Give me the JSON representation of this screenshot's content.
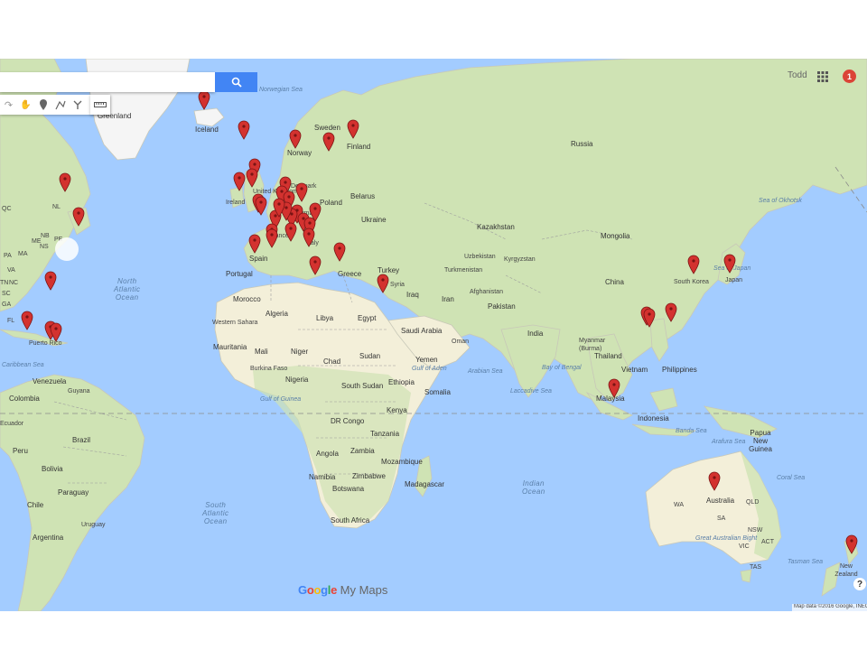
{
  "search": {
    "placeholder": "",
    "button_icon": "search-icon"
  },
  "toolbar": {
    "tools": [
      {
        "name": "redo-button",
        "icon": "redo-icon",
        "glyph": "↷"
      },
      {
        "name": "hand-button",
        "icon": "hand-icon",
        "glyph": "✋"
      },
      {
        "name": "add-marker-button",
        "icon": "marker-icon",
        "glyph": "⚲"
      },
      {
        "name": "draw-line-button",
        "icon": "polyline-icon",
        "glyph": "⟋"
      },
      {
        "name": "directions-button",
        "icon": "directions-icon",
        "glyph": "⑂"
      }
    ],
    "ruler_icon": "ruler-icon"
  },
  "account": {
    "user_name": "Todd",
    "apps_icon": "apps-grid-icon",
    "notification_count": "1"
  },
  "branding": {
    "google": "Google",
    "product": "My Maps"
  },
  "attribution": "Map data ©2016 Google, INEGI",
  "help_label": "?",
  "colors": {
    "ocean": "#a3ccff",
    "land": "#e9efd9",
    "marker": "#d3322f",
    "search_button": "#4285f4",
    "notification": "#db4437"
  },
  "labels": {
    "oceans": [
      {
        "id": "north-atlantic",
        "text": "North\nAtlantic\nOcean"
      },
      {
        "id": "south-atlantic",
        "text": "South\nAtlantic\nOcean"
      },
      {
        "id": "indian",
        "text": "Indian\nOcean"
      }
    ],
    "seas": [
      "Norwegian Sea",
      "Caribbean Sea",
      "Arabian Sea",
      "Bay of Bengal",
      "Laccadive Sea",
      "Sea of Japan",
      "Sea of Okhotsk",
      "Coral Sea",
      "Tasman Sea",
      "Gulf of Aden",
      "Gulf of Guinea",
      "Arafura Sea",
      "Banda Sea",
      "Great Australian Bight"
    ],
    "countries": [
      "Greenland",
      "Iceland",
      "Norway",
      "Sweden",
      "Finland",
      "Russia",
      "Denmark",
      "United Kingdom",
      "Ireland",
      "Poland",
      "Belarus",
      "Ukraine",
      "Germany",
      "France",
      "Spain",
      "Portugal",
      "Italy",
      "Greece",
      "Turkey",
      "Kazakhstan",
      "Mongolia",
      "Uzbekistan",
      "Kyrgyzstan",
      "Turkmenistan",
      "Afghanistan",
      "Pakistan",
      "Iran",
      "Iraq",
      "Syria",
      "Saudi Arabia",
      "Yemen",
      "Oman",
      "Egypt",
      "Libya",
      "Algeria",
      "Morocco",
      "Western Sahara",
      "Mauritania",
      "Mali",
      "Niger",
      "Chad",
      "Sudan",
      "South Sudan",
      "Ethiopia",
      "Kenya",
      "Somalia",
      "Nigeria",
      "Burkina Faso",
      "DR Congo",
      "Tanzania",
      "Angola",
      "Zambia",
      "Namibia",
      "Zimbabwe",
      "Botswana",
      "Mozambique",
      "Madagascar",
      "South Africa",
      "India",
      "China",
      "Myanmar (Burma)",
      "Thailand",
      "Vietnam",
      "Philippines",
      "Malaysia",
      "Indonesia",
      "Papua New Guinea",
      "South Korea",
      "Japan",
      "Australia",
      "New Zealand",
      "Colombia",
      "Venezuela",
      "Guyana",
      "Ecuador",
      "Peru",
      "Brazil",
      "Bolivia",
      "Paraguay",
      "Chile",
      "Argentina",
      "Uruguay",
      "Puerto Rico"
    ],
    "region_codes": [
      "QC",
      "NB",
      "NS",
      "ME",
      "PE",
      "NL",
      "MA",
      "PA",
      "VA",
      "NC",
      "SC",
      "GA",
      "FL",
      "TN",
      "NT",
      "WA",
      "SA",
      "QLD",
      "NSW",
      "ACT",
      "VIC",
      "TAS"
    ]
  },
  "markers_count": 44
}
